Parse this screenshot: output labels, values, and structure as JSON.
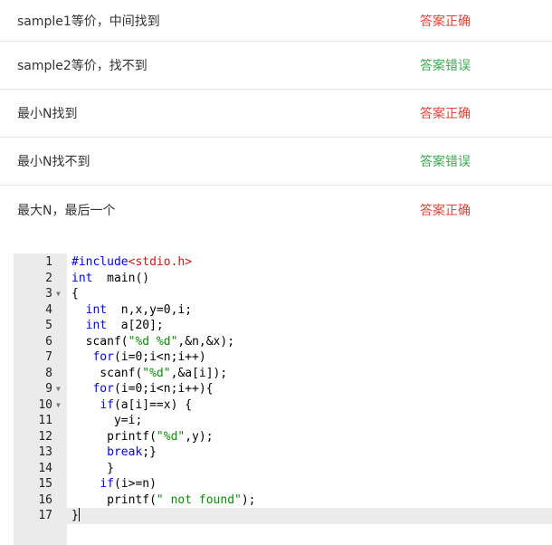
{
  "colors": {
    "correct": "#e0453c",
    "wrong": "#3fa954",
    "keyword": "#0000ff",
    "string": "#0a8c0a",
    "include_header": "#c41a16"
  },
  "test_cases": [
    {
      "name": "sample1等价，中间找到",
      "result": "答案正确"
    },
    {
      "name": "sample2等价，找不到",
      "result": "答案错误"
    },
    {
      "name": "最小N找到",
      "result": "答案正确"
    },
    {
      "name": "最小N找不到",
      "result": "答案错误"
    },
    {
      "name": "最大N，最后一个",
      "result": "答案正确"
    }
  ],
  "code": {
    "fold_icon": "triangle-down",
    "active_line": 17,
    "lines": [
      {
        "n": "1",
        "fold": false,
        "tokens": [
          [
            "kw",
            "#include"
          ],
          [
            "inc",
            "<stdio.h>"
          ]
        ]
      },
      {
        "n": "2",
        "fold": false,
        "tokens": [
          [
            "kw",
            "int"
          ],
          [
            "",
            "  main()"
          ]
        ]
      },
      {
        "n": "3",
        "fold": true,
        "tokens": [
          [
            "",
            "{"
          ]
        ]
      },
      {
        "n": "4",
        "fold": false,
        "tokens": [
          [
            "",
            "  "
          ],
          [
            "kw",
            "int"
          ],
          [
            "",
            "  n,x,y=0,i;"
          ]
        ]
      },
      {
        "n": "5",
        "fold": false,
        "tokens": [
          [
            "",
            "  "
          ],
          [
            "kw",
            "int"
          ],
          [
            "",
            "  a[20];"
          ]
        ]
      },
      {
        "n": "6",
        "fold": false,
        "tokens": [
          [
            "",
            "  scanf("
          ],
          [
            "str",
            "\"%d %d\""
          ],
          [
            "",
            ",&n,&x);"
          ]
        ]
      },
      {
        "n": "7",
        "fold": false,
        "tokens": [
          [
            "",
            "   "
          ],
          [
            "kw",
            "for"
          ],
          [
            "",
            "(i=0;i<n;i++)"
          ]
        ]
      },
      {
        "n": "8",
        "fold": false,
        "tokens": [
          [
            "",
            "    scanf("
          ],
          [
            "str",
            "\"%d\""
          ],
          [
            "",
            ",&a[i]);"
          ]
        ]
      },
      {
        "n": "9",
        "fold": true,
        "tokens": [
          [
            "",
            "   "
          ],
          [
            "kw",
            "for"
          ],
          [
            "",
            "(i=0;i<n;i++){"
          ]
        ]
      },
      {
        "n": "10",
        "fold": true,
        "tokens": [
          [
            "",
            "    "
          ],
          [
            "kw",
            "if"
          ],
          [
            "",
            "(a[i]==x) {"
          ]
        ]
      },
      {
        "n": "11",
        "fold": false,
        "tokens": [
          [
            "",
            "      y=i;"
          ]
        ]
      },
      {
        "n": "12",
        "fold": false,
        "tokens": [
          [
            "",
            "     printf("
          ],
          [
            "str",
            "\"%d\""
          ],
          [
            "",
            ",y);"
          ]
        ]
      },
      {
        "n": "13",
        "fold": false,
        "tokens": [
          [
            "",
            "     "
          ],
          [
            "kw",
            "break"
          ],
          [
            "",
            ";}"
          ]
        ]
      },
      {
        "n": "14",
        "fold": false,
        "tokens": [
          [
            "",
            "     }"
          ]
        ]
      },
      {
        "n": "15",
        "fold": false,
        "tokens": [
          [
            "",
            "    "
          ],
          [
            "kw",
            "if"
          ],
          [
            "",
            "(i>=n)"
          ]
        ]
      },
      {
        "n": "16",
        "fold": false,
        "tokens": [
          [
            "",
            "     printf("
          ],
          [
            "str",
            "\" not found\""
          ],
          [
            "",
            ");"
          ]
        ]
      },
      {
        "n": "17",
        "fold": false,
        "tokens": [
          [
            "",
            "}"
          ]
        ]
      }
    ]
  }
}
